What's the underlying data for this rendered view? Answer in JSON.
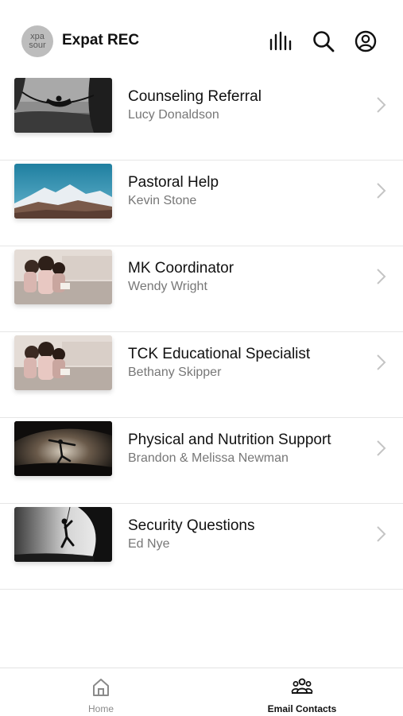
{
  "header": {
    "title": "Expat REC",
    "logo_text_line1": "xpa",
    "logo_text_line2": "sour",
    "icons": [
      "bar-chart-icon",
      "search-icon",
      "user-circle-icon"
    ]
  },
  "contacts": [
    {
      "title": "Counseling Referral",
      "name": "Lucy Donaldson",
      "image": "hammock-photo"
    },
    {
      "title": "Pastoral Help",
      "name": "Kevin Stone",
      "image": "mountains-photo"
    },
    {
      "title": "MK Coordinator",
      "name": "Wendy Wright",
      "image": "children-reading-photo"
    },
    {
      "title": "TCK Educational Specialist",
      "name": "Bethany Skipper",
      "image": "children-reading-photo"
    },
    {
      "title": "Physical and Nutrition Support",
      "name": "Brandon & Melissa Newman",
      "image": "yoga-silhouette-photo"
    },
    {
      "title": "Security Questions",
      "name": "Ed Nye",
      "image": "climber-silhouette-photo"
    }
  ],
  "tabs": [
    {
      "label": "Home",
      "icon": "home-icon",
      "active": false
    },
    {
      "label": "Email Contacts",
      "icon": "people-group-icon",
      "active": true
    }
  ],
  "colors": {
    "accent": "#111111",
    "inactive_tab": "#8a8a8a",
    "subtitle": "#777777",
    "divider": "#e6e6e6"
  }
}
